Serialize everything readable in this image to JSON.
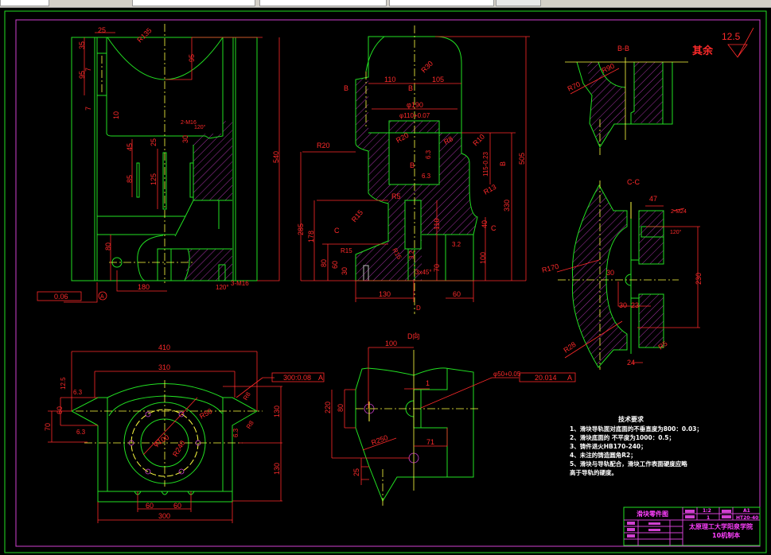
{
  "app": {
    "colors": {
      "background": "#000000",
      "outline": "#22e022",
      "dimension": "#ff2a2a",
      "centerline": "#ffff40",
      "hatch": "#d040d0",
      "frame": "#d040d0"
    }
  },
  "front_view": {
    "dims": [
      "25",
      "R135",
      "35",
      "95",
      "7",
      "7",
      "95",
      "10",
      "45",
      "85",
      "25",
      "125",
      "30",
      "2-M16",
      "120°",
      "540",
      "80",
      "180",
      "120°",
      "3-M16",
      "0.06",
      "A"
    ]
  },
  "section_view": {
    "dims": [
      "R30",
      "110",
      "105",
      "B",
      "B",
      "φ190",
      "φ110+0.07",
      "R20",
      "R20",
      "R8",
      "R10",
      "115-0.23",
      "6.3",
      "6.3",
      "B",
      "B",
      "505",
      "285",
      "R5",
      "R15",
      "R13",
      "330",
      "178",
      "110",
      "40",
      "C",
      "C",
      "R15",
      "R15",
      "80",
      "60",
      "30",
      "3.2",
      "3.2",
      "100",
      "70",
      "3x45°",
      "130",
      "60",
      "D"
    ]
  },
  "bb_view": {
    "title": "B-B",
    "dims": [
      "R90",
      "R70"
    ]
  },
  "roughness": {
    "value": "12.5",
    "label": "其余"
  },
  "cc_view": {
    "title": "C-C",
    "dims": [
      "47",
      "2-M24",
      "120°",
      "R170",
      "30",
      "30",
      "23",
      "230",
      "R28",
      "R5",
      "24"
    ]
  },
  "top_view": {
    "dims": [
      "410",
      "310",
      "300:0.08",
      "A",
      "12.5",
      "6.3",
      "60",
      "70",
      "6.3",
      "R8",
      "R8",
      "6.3",
      "R50",
      "φ100",
      "R240",
      "130",
      "130",
      "60",
      "60",
      "300"
    ]
  },
  "d_view": {
    "title": "D向",
    "dims": [
      "100",
      "1",
      "φ50+0.05",
      "20.014",
      "A",
      "220",
      "80",
      "R250",
      "71",
      "25"
    ]
  },
  "tech_requirements": {
    "title": "技术要求",
    "lines": [
      "1、滑块导轨面对底面的不垂直度为800：0.03；",
      "2、滑块底面的 不平度为1000：0.5；",
      "3、铸件退火HB170-240；",
      "4、未注的铸造圆角R2；",
      "5、滑块与导轨配合，滑块工作表面硬度应略",
      "高于导轨的硬度。"
    ]
  },
  "title_block": {
    "drawing_name": "滑块零件图",
    "scale": "1:2",
    "quantity": "1",
    "sheet": "A1",
    "material": "HT20-40",
    "school": "太原理工大学阳泉学院",
    "class": "10机制本"
  }
}
